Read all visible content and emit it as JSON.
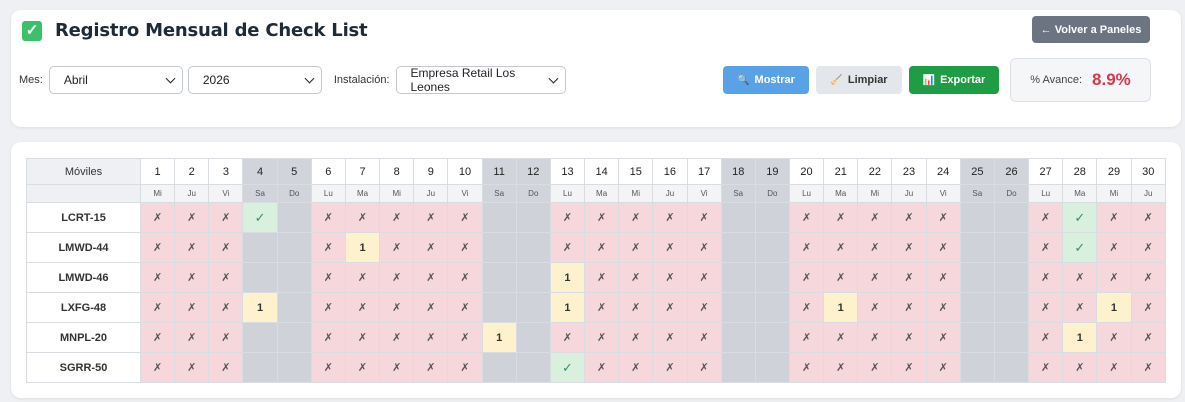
{
  "header": {
    "title": "Registro Mensual de Check List",
    "back_label": "← Volver a Paneles"
  },
  "filters": {
    "month_label": "Mes:",
    "month_value": "Abril",
    "year_value": "2026",
    "installation_label": "Instalación:",
    "installation_value": "Empresa Retail Los Leones"
  },
  "actions": {
    "show_label": "Mostrar",
    "clear_label": "Limpiar",
    "export_label": "Exportar"
  },
  "progress": {
    "label": "% Avance:",
    "value": "8.9%"
  },
  "grid": {
    "corner_label": "Móviles",
    "days": [
      "1",
      "2",
      "3",
      "4",
      "5",
      "6",
      "7",
      "8",
      "9",
      "10",
      "11",
      "12",
      "13",
      "14",
      "15",
      "16",
      "17",
      "18",
      "19",
      "20",
      "21",
      "22",
      "23",
      "24",
      "25",
      "26",
      "27",
      "28",
      "29",
      "30"
    ],
    "weekdays": [
      "Mi",
      "Ju",
      "Vi",
      "Sa",
      "Do",
      "Lu",
      "Ma",
      "Mi",
      "Ju",
      "Vi",
      "Sa",
      "Do",
      "Lu",
      "Ma",
      "Mi",
      "Ju",
      "Vi",
      "Sa",
      "Do",
      "Lu",
      "Ma",
      "Mi",
      "Ju",
      "Vi",
      "Sa",
      "Do",
      "Lu",
      "Ma",
      "Mi",
      "Ju"
    ],
    "weekend_days": [
      4,
      5,
      11,
      12,
      18,
      19,
      25,
      26
    ],
    "symbols": {
      "miss": "✗",
      "ok": "✓"
    },
    "rows": [
      {
        "name": "LCRT-15",
        "cells": [
          "x",
          "x",
          "x",
          "ok",
          "",
          "x",
          "x",
          "x",
          "x",
          "x",
          "",
          "",
          "x",
          "x",
          "x",
          "x",
          "x",
          "",
          "",
          "x",
          "x",
          "x",
          "x",
          "x",
          "",
          "",
          "x",
          "ok",
          "x",
          "x"
        ]
      },
      {
        "name": "LMWD-44",
        "cells": [
          "x",
          "x",
          "x",
          "",
          "",
          "x",
          "1",
          "x",
          "x",
          "x",
          "",
          "",
          "x",
          "x",
          "x",
          "x",
          "x",
          "",
          "",
          "x",
          "x",
          "x",
          "x",
          "x",
          "",
          "",
          "x",
          "ok",
          "x",
          "x"
        ]
      },
      {
        "name": "LMWD-46",
        "cells": [
          "x",
          "x",
          "x",
          "",
          "",
          "x",
          "x",
          "x",
          "x",
          "x",
          "",
          "",
          "1",
          "x",
          "x",
          "x",
          "x",
          "",
          "",
          "x",
          "x",
          "x",
          "x",
          "x",
          "",
          "",
          "x",
          "x",
          "x",
          "x"
        ]
      },
      {
        "name": "LXFG-48",
        "cells": [
          "x",
          "x",
          "x",
          "1",
          "",
          "x",
          "x",
          "x",
          "x",
          "x",
          "",
          "",
          "1",
          "x",
          "x",
          "x",
          "x",
          "",
          "",
          "x",
          "1",
          "x",
          "x",
          "x",
          "",
          "",
          "x",
          "x",
          "1",
          "x"
        ]
      },
      {
        "name": "MNPL-20",
        "cells": [
          "x",
          "x",
          "x",
          "",
          "",
          "x",
          "x",
          "x",
          "x",
          "x",
          "1",
          "",
          "x",
          "x",
          "x",
          "x",
          "x",
          "",
          "",
          "x",
          "x",
          "x",
          "x",
          "x",
          "",
          "",
          "x",
          "1",
          "x",
          "x"
        ]
      },
      {
        "name": "SGRR-50",
        "cells": [
          "x",
          "x",
          "x",
          "",
          "",
          "x",
          "x",
          "x",
          "x",
          "x",
          "",
          "",
          "ok",
          "x",
          "x",
          "x",
          "x",
          "",
          "",
          "x",
          "x",
          "x",
          "x",
          "x",
          "",
          "",
          "x",
          "x",
          "x",
          "x"
        ]
      }
    ]
  }
}
